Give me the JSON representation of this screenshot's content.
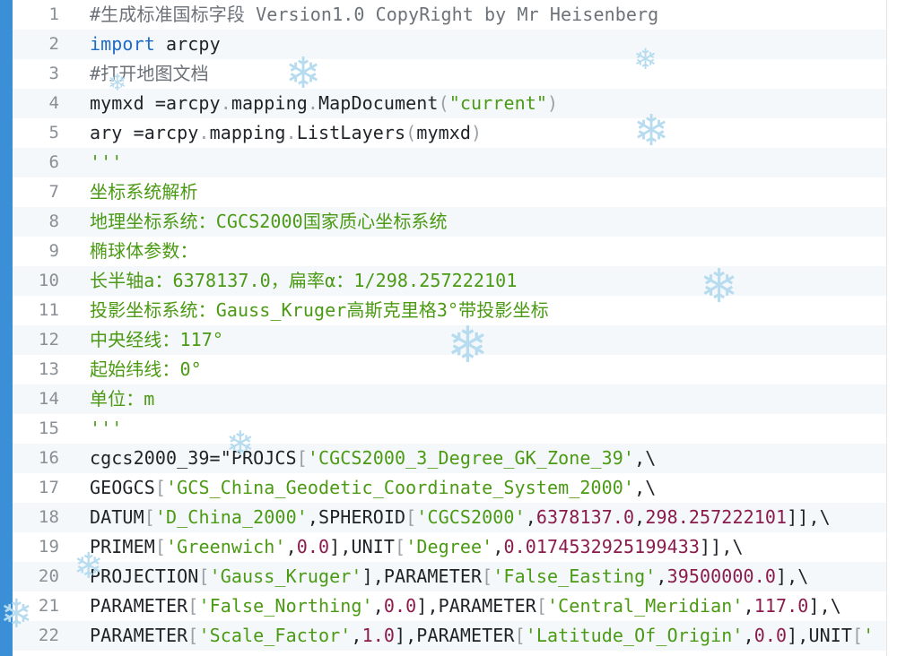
{
  "editor": {
    "lines": [
      {
        "n": "1",
        "segs": [
          {
            "t": "#生成标准国标字段 Version1.0 CopyRight by Mr Heisenberg",
            "c": "comment"
          }
        ]
      },
      {
        "n": "2",
        "segs": [
          {
            "t": "import",
            "c": "kw"
          },
          {
            "t": " arcpy",
            "c": ""
          }
        ]
      },
      {
        "n": "3",
        "segs": [
          {
            "t": "#打开地图文档",
            "c": "comment"
          }
        ]
      },
      {
        "n": "4",
        "segs": [
          {
            "t": "mymxd =arcpy",
            "c": ""
          },
          {
            "t": ".",
            "c": "punct"
          },
          {
            "t": "mapping",
            "c": ""
          },
          {
            "t": ".",
            "c": "punct"
          },
          {
            "t": "MapDocument",
            "c": ""
          },
          {
            "t": "(",
            "c": "punct"
          },
          {
            "t": "\"current\"",
            "c": "str"
          },
          {
            "t": ")",
            "c": "punct"
          }
        ]
      },
      {
        "n": "5",
        "segs": [
          {
            "t": "ary =arcpy",
            "c": ""
          },
          {
            "t": ".",
            "c": "punct"
          },
          {
            "t": "mapping",
            "c": ""
          },
          {
            "t": ".",
            "c": "punct"
          },
          {
            "t": "ListLayers",
            "c": ""
          },
          {
            "t": "(",
            "c": "punct"
          },
          {
            "t": "mymxd",
            "c": ""
          },
          {
            "t": ")",
            "c": "punct"
          }
        ]
      },
      {
        "n": "6",
        "segs": [
          {
            "t": "'''",
            "c": "str"
          }
        ]
      },
      {
        "n": "7",
        "segs": [
          {
            "t": "坐标系统解析",
            "c": "str"
          }
        ]
      },
      {
        "n": "8",
        "segs": [
          {
            "t": "地理坐标系统：CGCS2000国家质心坐标系统",
            "c": "str"
          }
        ]
      },
      {
        "n": "9",
        "segs": [
          {
            "t": "椭球体参数：",
            "c": "str"
          }
        ]
      },
      {
        "n": "10",
        "segs": [
          {
            "t": "长半轴a：6378137.0，扁率α：1/298.257222101",
            "c": "str"
          }
        ]
      },
      {
        "n": "11",
        "segs": [
          {
            "t": "投影坐标系统：Gauss_Kruger高斯克里格3°带投影坐标",
            "c": "str"
          }
        ]
      },
      {
        "n": "12",
        "segs": [
          {
            "t": "中央经线：117°",
            "c": "str"
          }
        ]
      },
      {
        "n": "13",
        "segs": [
          {
            "t": "起始纬线：0°",
            "c": "str"
          }
        ]
      },
      {
        "n": "14",
        "segs": [
          {
            "t": "单位：m",
            "c": "str"
          }
        ]
      },
      {
        "n": "15",
        "segs": [
          {
            "t": "'''",
            "c": "str"
          }
        ]
      },
      {
        "n": "16",
        "segs": [
          {
            "t": "cgcs2000_39=\"PROJCS",
            "c": ""
          },
          {
            "t": "[",
            "c": "punct"
          },
          {
            "t": "'CGCS2000_3_Degree_GK_Zone_39'",
            "c": "str"
          },
          {
            "t": ",\\",
            "c": ""
          }
        ]
      },
      {
        "n": "17",
        "segs": [
          {
            "t": "GEOGCS",
            "c": ""
          },
          {
            "t": "[",
            "c": "punct"
          },
          {
            "t": "'GCS_China_Geodetic_Coordinate_System_2000'",
            "c": "str"
          },
          {
            "t": ",\\",
            "c": ""
          }
        ]
      },
      {
        "n": "18",
        "segs": [
          {
            "t": "DATUM",
            "c": ""
          },
          {
            "t": "[",
            "c": "punct"
          },
          {
            "t": "'D_China_2000'",
            "c": "str"
          },
          {
            "t": ",SPHEROID",
            "c": ""
          },
          {
            "t": "[",
            "c": "punct"
          },
          {
            "t": "'CGCS2000'",
            "c": "str"
          },
          {
            "t": ",",
            "c": ""
          },
          {
            "t": "6378137.0",
            "c": "num"
          },
          {
            "t": ",",
            "c": ""
          },
          {
            "t": "298.257222101",
            "c": "num"
          },
          {
            "t": "]],\\",
            "c": ""
          }
        ]
      },
      {
        "n": "19",
        "segs": [
          {
            "t": "PRIMEM",
            "c": ""
          },
          {
            "t": "[",
            "c": "punct"
          },
          {
            "t": "'Greenwich'",
            "c": "str"
          },
          {
            "t": ",",
            "c": ""
          },
          {
            "t": "0.0",
            "c": "num"
          },
          {
            "t": "],UNIT",
            "c": ""
          },
          {
            "t": "[",
            "c": "punct"
          },
          {
            "t": "'Degree'",
            "c": "str"
          },
          {
            "t": ",",
            "c": ""
          },
          {
            "t": "0.0174532925199433",
            "c": "num"
          },
          {
            "t": "]],\\",
            "c": ""
          }
        ]
      },
      {
        "n": "20",
        "segs": [
          {
            "t": "PROJECTION",
            "c": ""
          },
          {
            "t": "[",
            "c": "punct"
          },
          {
            "t": "'Gauss_Kruger'",
            "c": "str"
          },
          {
            "t": "],PARAMETER",
            "c": ""
          },
          {
            "t": "[",
            "c": "punct"
          },
          {
            "t": "'False_Easting'",
            "c": "str"
          },
          {
            "t": ",",
            "c": ""
          },
          {
            "t": "39500000.0",
            "c": "num"
          },
          {
            "t": "],\\",
            "c": ""
          }
        ]
      },
      {
        "n": "21",
        "segs": [
          {
            "t": "PARAMETER",
            "c": ""
          },
          {
            "t": "[",
            "c": "punct"
          },
          {
            "t": "'False_Northing'",
            "c": "str"
          },
          {
            "t": ",",
            "c": ""
          },
          {
            "t": "0.0",
            "c": "num"
          },
          {
            "t": "],PARAMETER",
            "c": ""
          },
          {
            "t": "[",
            "c": "punct"
          },
          {
            "t": "'Central_Meridian'",
            "c": "str"
          },
          {
            "t": ",",
            "c": ""
          },
          {
            "t": "117.0",
            "c": "num"
          },
          {
            "t": "],\\",
            "c": ""
          }
        ]
      },
      {
        "n": "22",
        "segs": [
          {
            "t": "PARAMETER",
            "c": ""
          },
          {
            "t": "[",
            "c": "punct"
          },
          {
            "t": "'Scale_Factor'",
            "c": "str"
          },
          {
            "t": ",",
            "c": ""
          },
          {
            "t": "1.0",
            "c": "num"
          },
          {
            "t": "],PARAMETER",
            "c": ""
          },
          {
            "t": "[",
            "c": "punct"
          },
          {
            "t": "'Latitude_Of_Origin'",
            "c": "str"
          },
          {
            "t": ",",
            "c": ""
          },
          {
            "t": "0.0",
            "c": "num"
          },
          {
            "t": "],UNIT",
            "c": ""
          },
          {
            "t": "[",
            "c": "punct"
          },
          {
            "t": "'",
            "c": "str"
          }
        ]
      }
    ]
  },
  "colors": {
    "accent_bar": "#3a8fd6",
    "comment": "#6c7278",
    "keyword": "#1e6cc4",
    "string": "#4b9a13",
    "number": "#8a1b4d",
    "snowflake": "#b7dcef"
  },
  "decorations": {
    "snowflake_glyph": "❄",
    "snowflake_icon": "snowflake-icon"
  }
}
